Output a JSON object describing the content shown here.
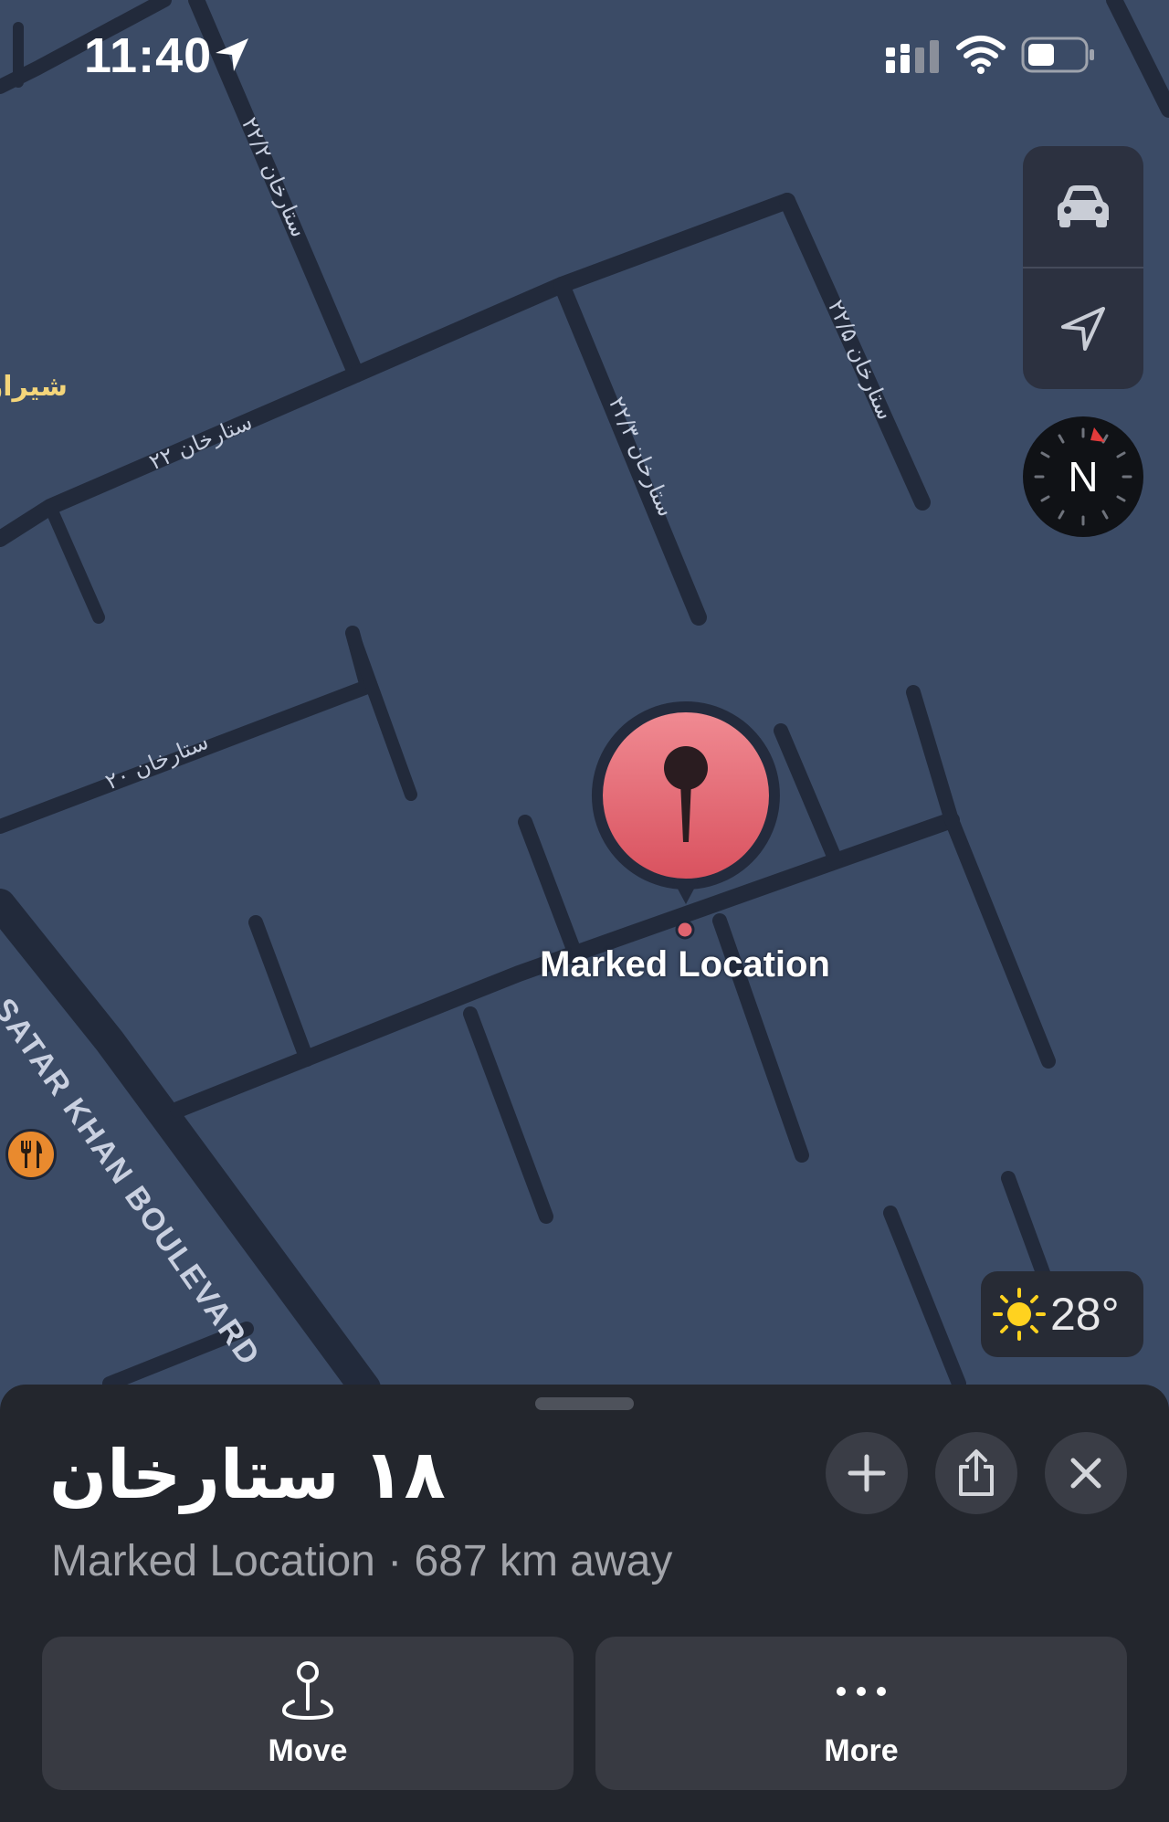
{
  "status_bar": {
    "time": "11:40",
    "location_arrow_icon": "location-arrow-icon",
    "signal_icon": "cellular-signal-icon",
    "wifi_icon": "wifi-icon",
    "battery_icon": "battery-icon"
  },
  "map": {
    "controls": {
      "drive_icon": "car-icon",
      "locate_icon": "location-arrow-outline-icon"
    },
    "compass_label": "N",
    "street_labels": [
      "۲۲ ستارخان",
      "۲۲/۲ ستارخان",
      "۲۲/۳ ستارخان",
      "۲۲/۵ ستارخان",
      "۲۰ ستارخان"
    ],
    "boulevard_label": "SATAR KHAN BOULEVARD",
    "poi_label": "شیراز",
    "pin_label": "Marked Location",
    "restaurant_icon": "fork-knife-icon",
    "weather": {
      "icon": "sun-icon",
      "temperature": "28°"
    },
    "colors": {
      "background": "#3b4b66",
      "road": "#232b3d",
      "pin": "#e0646f"
    }
  },
  "sheet": {
    "title": "۱۸ ستارخان",
    "subtitle": "Marked Location · 687 km away",
    "add_icon": "plus-icon",
    "share_icon": "share-icon",
    "close_icon": "close-icon",
    "actions": [
      {
        "label": "Move",
        "icon": "move-pin-icon"
      },
      {
        "label": "More",
        "icon": "ellipsis-icon"
      }
    ]
  }
}
